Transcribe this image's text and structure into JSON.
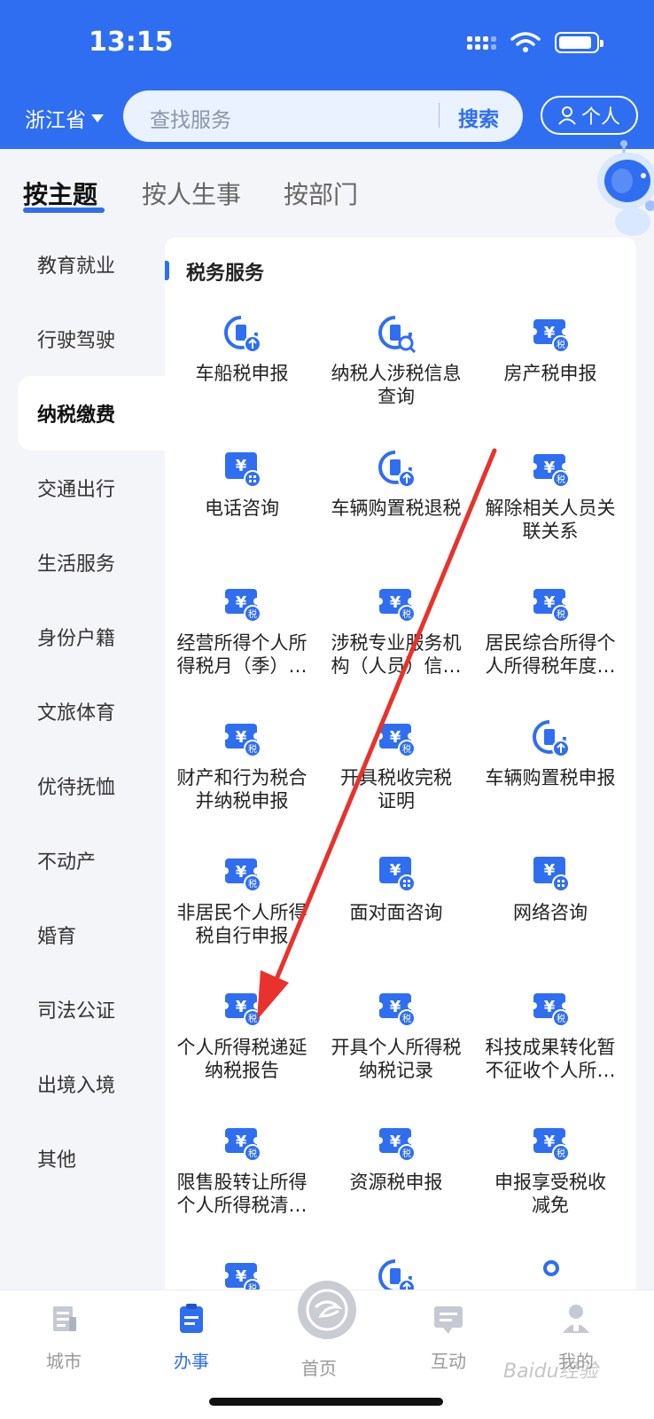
{
  "status_bar": {
    "time": "13:15"
  },
  "header": {
    "province": "浙江省",
    "search_placeholder": "查找服务",
    "search_button": "搜索",
    "personal_button": "个人"
  },
  "top_tabs": [
    {
      "label": "按主题",
      "active": true
    },
    {
      "label": "按人生事",
      "active": false
    },
    {
      "label": "按部门",
      "active": false
    }
  ],
  "categories": [
    {
      "label": "教育就业",
      "active": false
    },
    {
      "label": "行驶驾驶",
      "active": false
    },
    {
      "label": "纳税缴费",
      "active": true
    },
    {
      "label": "交通出行",
      "active": false
    },
    {
      "label": "生活服务",
      "active": false
    },
    {
      "label": "身份户籍",
      "active": false
    },
    {
      "label": "文旅体育",
      "active": false
    },
    {
      "label": "优待抚恤",
      "active": false
    },
    {
      "label": "不动产",
      "active": false
    },
    {
      "label": "婚育",
      "active": false
    },
    {
      "label": "司法公证",
      "active": false
    },
    {
      "label": "出境入境",
      "active": false
    },
    {
      "label": "其他",
      "active": false
    }
  ],
  "section_title": "税务服务",
  "services": [
    {
      "line1": "车船税申报",
      "line2": "",
      "icon": "tax-declare-icon"
    },
    {
      "line1": "纳税人涉税信息",
      "line2": "查询",
      "icon": "tax-search-icon"
    },
    {
      "line1": "房产税申报",
      "line2": "",
      "icon": "tax-ticket-icon"
    },
    {
      "line1": "电话咨询",
      "line2": "",
      "icon": "consult-icon"
    },
    {
      "line1": "车辆购置税退税",
      "line2": "",
      "icon": "tax-declare-icon"
    },
    {
      "line1": "解除相关人员关",
      "line2": "联关系",
      "icon": "tax-ticket-icon"
    },
    {
      "line1": "经营所得个人所",
      "line2": "得税月（季）…",
      "icon": "tax-ticket-icon"
    },
    {
      "line1": "涉税专业服务机",
      "line2": "构（人员）信…",
      "icon": "tax-ticket-icon"
    },
    {
      "line1": "居民综合所得个",
      "line2": "人所得税年度…",
      "icon": "tax-ticket-icon"
    },
    {
      "line1": "财产和行为税合",
      "line2": "并纳税申报",
      "icon": "tax-ticket-icon"
    },
    {
      "line1": "开具税收完税",
      "line2": "证明",
      "icon": "tax-ticket-icon"
    },
    {
      "line1": "车辆购置税申报",
      "line2": "",
      "icon": "tax-declare-icon"
    },
    {
      "line1": "非居民个人所得",
      "line2": "税自行申报",
      "icon": "tax-ticket-icon"
    },
    {
      "line1": "面对面咨询",
      "line2": "",
      "icon": "consult-icon"
    },
    {
      "line1": "网络咨询",
      "line2": "",
      "icon": "consult-icon"
    },
    {
      "line1": "个人所得税递延",
      "line2": "纳税报告",
      "icon": "tax-ticket-icon"
    },
    {
      "line1": "开具个人所得税",
      "line2": "纳税记录",
      "icon": "tax-ticket-icon"
    },
    {
      "line1": "科技成果转化暂",
      "line2": "不征收个人所…",
      "icon": "tax-ticket-icon"
    },
    {
      "line1": "限售股转让所得",
      "line2": "个人所得税清…",
      "icon": "tax-ticket-icon"
    },
    {
      "line1": "资源税申报",
      "line2": "",
      "icon": "tax-ticket-icon"
    },
    {
      "line1": "申报享受税收",
      "line2": "减免",
      "icon": "tax-ticket-icon"
    }
  ],
  "bottom_nav": [
    {
      "label": "城市",
      "icon": "city-icon",
      "active": false
    },
    {
      "label": "办事",
      "icon": "affairs-icon",
      "active": true
    },
    {
      "label": "首页",
      "icon": "home-logo-icon",
      "active": false
    },
    {
      "label": "互动",
      "icon": "chat-icon",
      "active": false
    },
    {
      "label": "我的",
      "icon": "profile-icon",
      "active": false
    }
  ],
  "watermark": "Baidu经验",
  "colors": {
    "primary": "#2f6ef1",
    "annotation_arrow": "#e8322b"
  }
}
